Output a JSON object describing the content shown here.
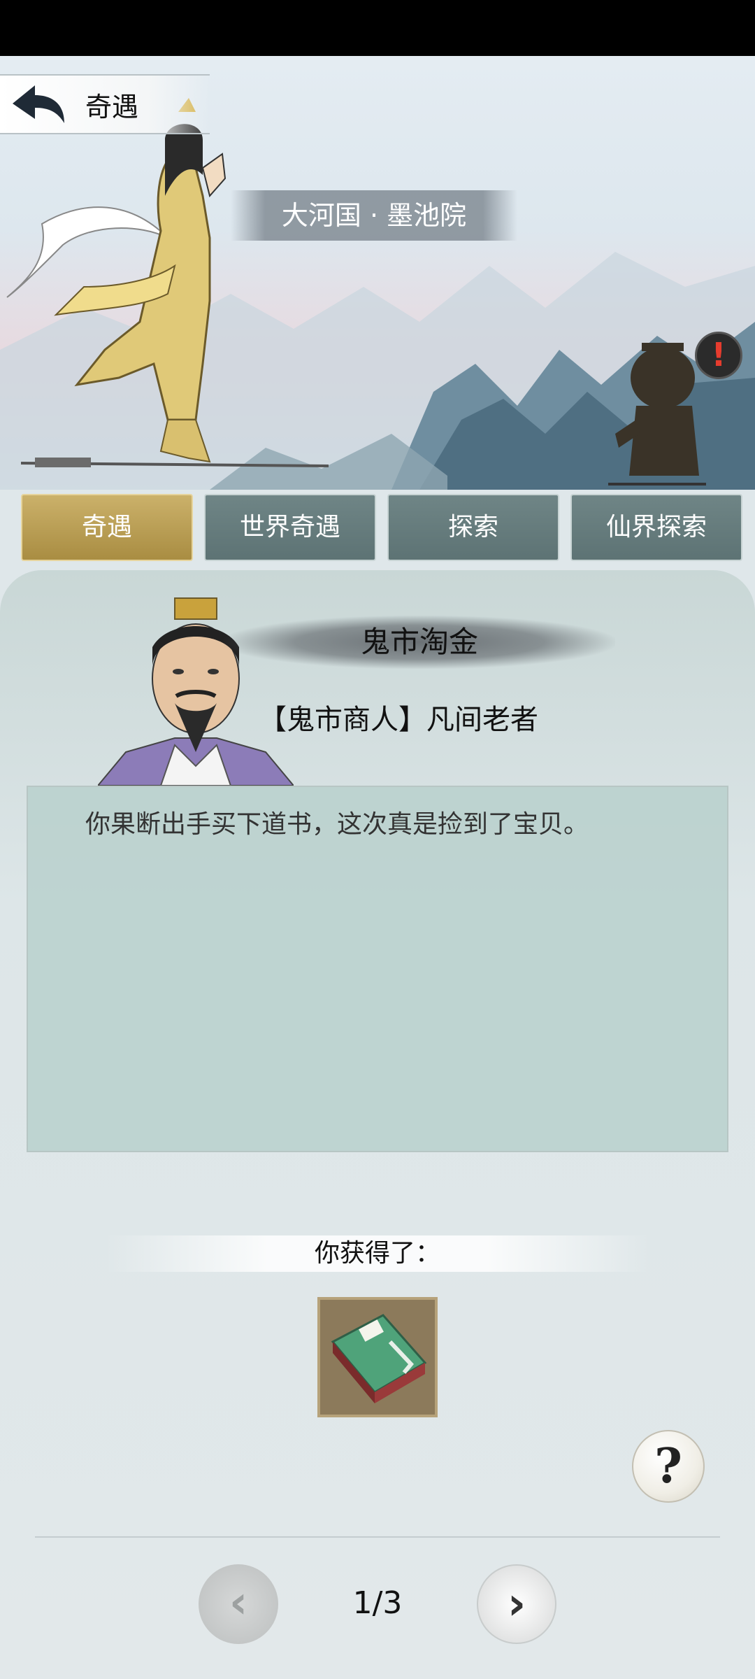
{
  "header": {
    "title": "奇遇"
  },
  "location": {
    "name": "大河国 · 墨池院"
  },
  "alert": {
    "symbol": "!"
  },
  "tabs": [
    {
      "label": "奇遇",
      "active": true
    },
    {
      "label": "世界奇遇",
      "active": false
    },
    {
      "label": "探索",
      "active": false
    },
    {
      "label": "仙界探索",
      "active": false
    }
  ],
  "event": {
    "name": "鬼市淘金",
    "npc": "【鬼市商人】凡间老者",
    "text": "你果断出手买下道书，这次真是捡到了宝贝。"
  },
  "reward": {
    "label": "你获得了：",
    "item_icon": "green-book-icon"
  },
  "help": {
    "symbol": "?"
  },
  "pagination": {
    "text": "1/3",
    "prev_symbol": "‹",
    "next_symbol": "›"
  },
  "colors": {
    "active_tab": "#b39a50",
    "tab": "#667c7d",
    "dialog_bg": "#b9d0cc"
  }
}
